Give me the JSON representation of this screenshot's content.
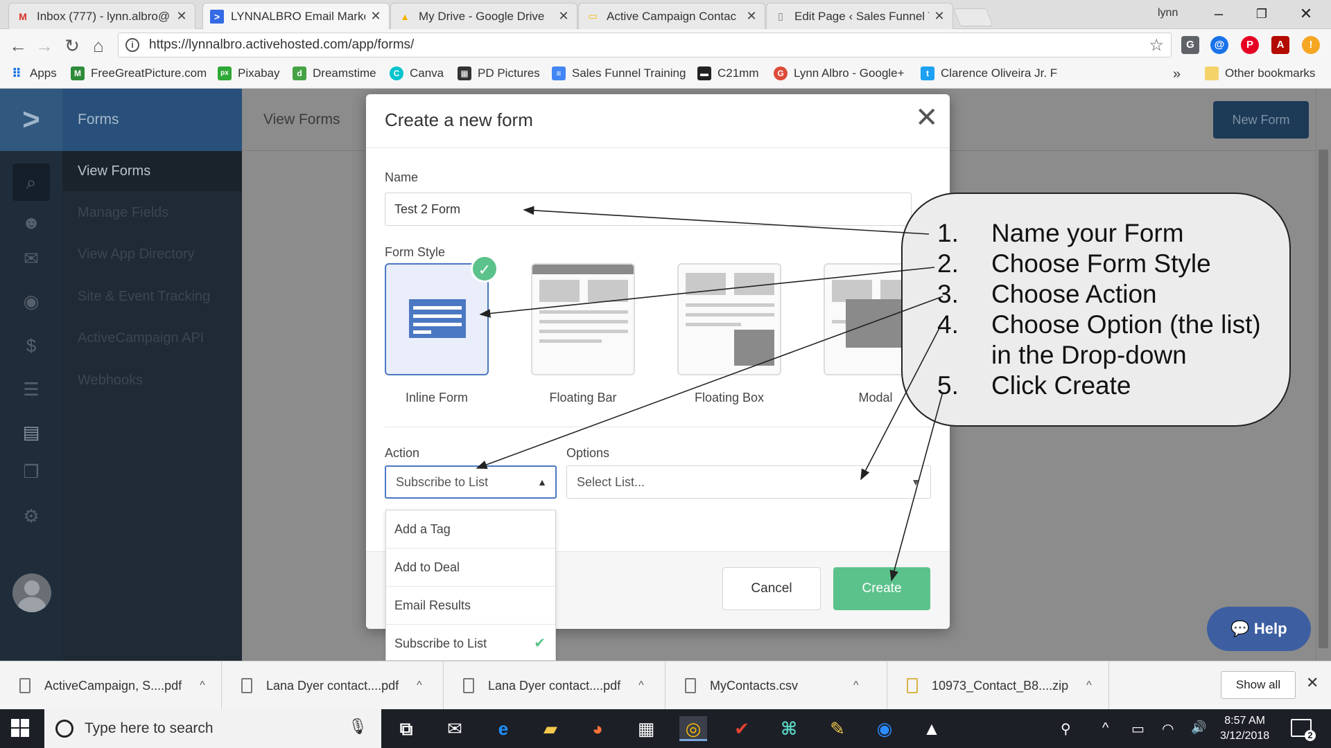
{
  "browser": {
    "tabs": [
      {
        "title": "Inbox (777) - lynn.albro@",
        "icon": "gmail-icon",
        "icon_glyph": "M",
        "icon_color": "#d93025"
      },
      {
        "title": "LYNNALBRO Email Marke",
        "icon": "activecampaign-icon",
        "icon_glyph": ">",
        "icon_color": "#356ae6"
      },
      {
        "title": "My Drive - Google Drive",
        "icon": "google-drive-icon",
        "icon_glyph": "▲",
        "icon_color": "#f4b400"
      },
      {
        "title": "Active Campaign Contac",
        "icon": "google-slides-icon",
        "icon_glyph": "▭",
        "icon_color": "#f4b400"
      },
      {
        "title": "Edit Page ‹ Sales Funnel T",
        "icon": "page-icon",
        "icon_glyph": "▯",
        "icon_color": "#777777"
      }
    ],
    "tab_close_glyph": "✕",
    "profile_name": "lynn",
    "window_controls": {
      "minimize": "–",
      "restore": "❐",
      "close": "✕"
    },
    "nav": {
      "back": "←",
      "forward": "→",
      "reload": "↻",
      "home": "⌂",
      "info": "i",
      "star": "☆"
    },
    "url": "https://lynnalbro.activehosted.com/app/forms/",
    "extensions": [
      {
        "name": "translate-ext-icon",
        "glyph": "G",
        "color": "#5f6368"
      },
      {
        "name": "a-ext-icon",
        "glyph": "@",
        "color": "#1a73e8"
      },
      {
        "name": "pinterest-icon",
        "glyph": "P",
        "color": "#e60023"
      },
      {
        "name": "acrobat-icon",
        "glyph": "A",
        "color": "#b30b00"
      },
      {
        "name": "honey-ext-icon",
        "glyph": "!",
        "color": "#f5a623"
      }
    ],
    "bookmarks": [
      {
        "label": "Apps",
        "icon": "apps-grid-icon",
        "glyph": "⠿",
        "color": "#1a73e8"
      },
      {
        "label": "FreeGreatPicture.com",
        "icon": "m-icon",
        "glyph": "M",
        "color": "#2e8b3a"
      },
      {
        "label": "Pixabay",
        "icon": "pixabay-icon",
        "glyph": "px",
        "color": "#2ea836"
      },
      {
        "label": "Dreamstime",
        "icon": "dreamstime-icon",
        "glyph": "d",
        "color": "#45a345"
      },
      {
        "label": "Canva",
        "icon": "canva-icon",
        "glyph": "C",
        "color": "#00c4cc"
      },
      {
        "label": "PD Pictures",
        "icon": "pd-pictures-icon",
        "glyph": "▦",
        "color": "#333333"
      },
      {
        "label": "Sales Funnel Training",
        "icon": "doc-icon",
        "glyph": "≡",
        "color": "#4285f4"
      },
      {
        "label": "C21mm",
        "icon": "c21-icon",
        "glyph": "▬",
        "color": "#222222"
      },
      {
        "label": "Lynn Albro - Google+",
        "icon": "google-plus-icon",
        "glyph": "G",
        "color": "#dd4b39"
      },
      {
        "label": "Clarence Oliveira Jr. F",
        "icon": "twitter-icon",
        "glyph": "t",
        "color": "#1da1f2"
      }
    ],
    "bookmarks_more": "»",
    "other_bookmarks": "Other bookmarks"
  },
  "app": {
    "section_title": "Forms",
    "page_header": "View Forms",
    "new_form_button": "New Form",
    "logo_glyph": ">",
    "rail_icons": [
      {
        "name": "search-icon",
        "glyph": "⌕"
      },
      {
        "name": "contacts-icon",
        "glyph": "☻"
      },
      {
        "name": "email-icon",
        "glyph": "✉"
      },
      {
        "name": "automation-icon",
        "glyph": "◉"
      },
      {
        "name": "deals-icon",
        "glyph": "$"
      },
      {
        "name": "lists-icon",
        "glyph": "☰"
      },
      {
        "name": "forms-icon",
        "glyph": "▤"
      },
      {
        "name": "pages-icon",
        "glyph": "❐"
      },
      {
        "name": "settings-icon",
        "glyph": "⚙"
      }
    ],
    "sidenav": [
      {
        "label": "View Forms",
        "active": true
      },
      {
        "label": "Manage Fields"
      },
      {
        "label": "View App Directory"
      },
      {
        "label": "Site & Event Tracking"
      },
      {
        "label": "ActiveCampaign API"
      },
      {
        "label": "Webhooks"
      }
    ]
  },
  "modal": {
    "title": "Create a new form",
    "close_glyph": "✕",
    "name_label": "Name",
    "name_value": "Test 2 Form",
    "style_label": "Form Style",
    "check_glyph": "✓",
    "styles": [
      {
        "label": "Inline Form",
        "selected": true
      },
      {
        "label": "Floating Bar"
      },
      {
        "label": "Floating Box"
      },
      {
        "label": "Modal"
      }
    ],
    "action_label": "Action",
    "action_value": "Subscribe to List",
    "options_label": "Options",
    "options_placeholder": "Select List...",
    "caret_up": "▲",
    "caret_down": "▼",
    "dropdown_items": [
      {
        "label": "Add a Tag"
      },
      {
        "label": "Add to Deal"
      },
      {
        "label": "Email Results"
      },
      {
        "label": "Subscribe to List",
        "checked": true
      }
    ],
    "tick_glyph": "✔",
    "cancel": "Cancel",
    "create": "Create"
  },
  "callout": {
    "steps": [
      {
        "num": "1.",
        "text": "Name your Form"
      },
      {
        "num": "2.",
        "text": "Choose Form Style"
      },
      {
        "num": "3.",
        "text": "Choose Action"
      },
      {
        "num": "4.",
        "text": "Choose Option (the list)"
      },
      {
        "num": "",
        "text": "in the Drop-down"
      },
      {
        "num": "5.",
        "text": "Click Create"
      }
    ]
  },
  "help_button": "Help",
  "help_glyph": "💬",
  "downloads": [
    {
      "name": "ActiveCampaign, S....pdf"
    },
    {
      "name": "Lana Dyer contact....pdf"
    },
    {
      "name": "Lana Dyer contact....pdf"
    },
    {
      "name": "MyContacts.csv"
    },
    {
      "name": "10973_Contact_B8....zip"
    }
  ],
  "download_caret": "^",
  "show_all": "Show all",
  "downloads_close": "✕",
  "taskbar": {
    "search_placeholder": "Type here to search",
    "mic_glyph": "🎙",
    "apps": [
      {
        "name": "task-view-icon",
        "glyph": "⧉",
        "color": "#ffffff"
      },
      {
        "name": "mail-app-icon",
        "glyph": "✉",
        "color": "#ffffff"
      },
      {
        "name": "edge-icon",
        "glyph": "e",
        "color": "#1e90ff"
      },
      {
        "name": "file-explorer-icon",
        "glyph": "▰",
        "color": "#f2c94c"
      },
      {
        "name": "firefox-icon",
        "glyph": "◕",
        "color": "#ff7139"
      },
      {
        "name": "store-icon",
        "glyph": "▦",
        "color": "#ffffff"
      },
      {
        "name": "chrome-icon",
        "glyph": "◎",
        "color": "#fbbc05"
      },
      {
        "name": "todoist-icon",
        "glyph": "✔",
        "color": "#e44332"
      },
      {
        "name": "app-icon",
        "glyph": "⌘",
        "color": "#5ad1c2"
      },
      {
        "name": "pencil-app-icon",
        "glyph": "✎",
        "color": "#f2c94c"
      },
      {
        "name": "zoom-icon",
        "glyph": "◉",
        "color": "#2d8cff"
      },
      {
        "name": "photos-icon",
        "glyph": "▲",
        "color": "#ffffff"
      }
    ],
    "tray": [
      {
        "name": "people-icon",
        "glyph": "⚲"
      },
      {
        "name": "show-hidden-icon",
        "glyph": "^"
      },
      {
        "name": "battery-icon",
        "glyph": "▭"
      },
      {
        "name": "wifi-icon",
        "glyph": "◠"
      },
      {
        "name": "volume-icon",
        "glyph": "🔊"
      }
    ],
    "time": "8:57 AM",
    "date": "3/12/2018",
    "notifications": "2"
  }
}
